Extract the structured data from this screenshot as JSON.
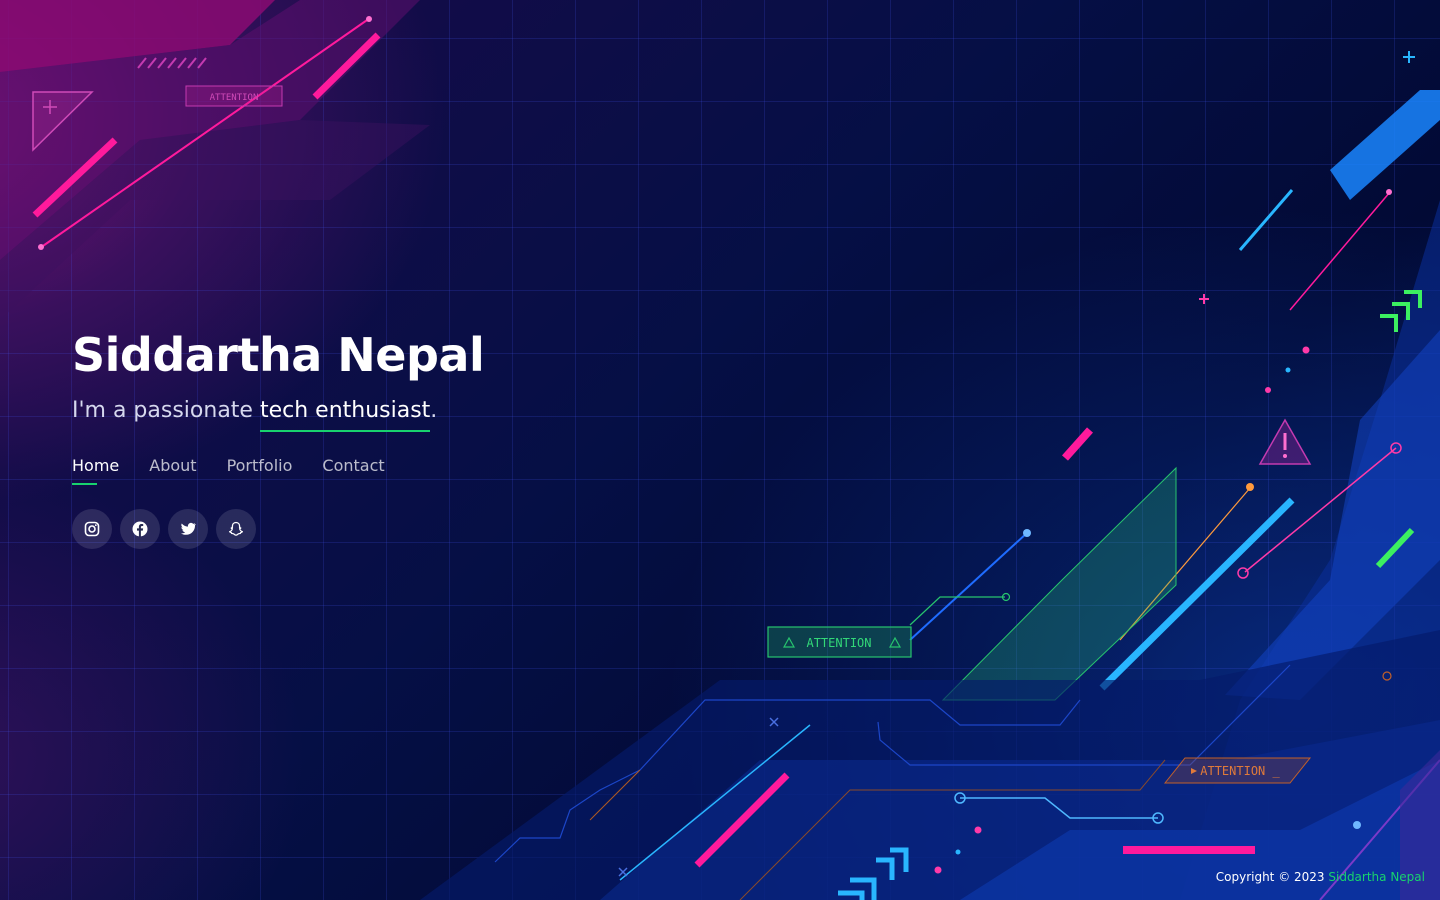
{
  "hero": {
    "name": "Siddartha Nepal",
    "tagline_prefix": "I'm a passionate ",
    "tagline_typed": "tech enthusiast",
    "tagline_suffix": "."
  },
  "nav": {
    "items": [
      {
        "label": "Home",
        "active": true
      },
      {
        "label": "About",
        "active": false
      },
      {
        "label": "Portfolio",
        "active": false
      },
      {
        "label": "Contact",
        "active": false
      }
    ]
  },
  "social": {
    "icons": [
      "instagram-icon",
      "facebook-icon",
      "twitter-icon",
      "snapchat-icon"
    ]
  },
  "decor": {
    "attention_label": "ATTENTION",
    "attention_label_orange": "ATTENTION _"
  },
  "footer": {
    "copyright": "Copyright © 2023 ",
    "owner": "Siddartha Nepal"
  },
  "colors": {
    "accent": "#18d26e",
    "background": "#020b38",
    "magenta": "#ff1a9c",
    "cyan": "#29b6ff"
  }
}
